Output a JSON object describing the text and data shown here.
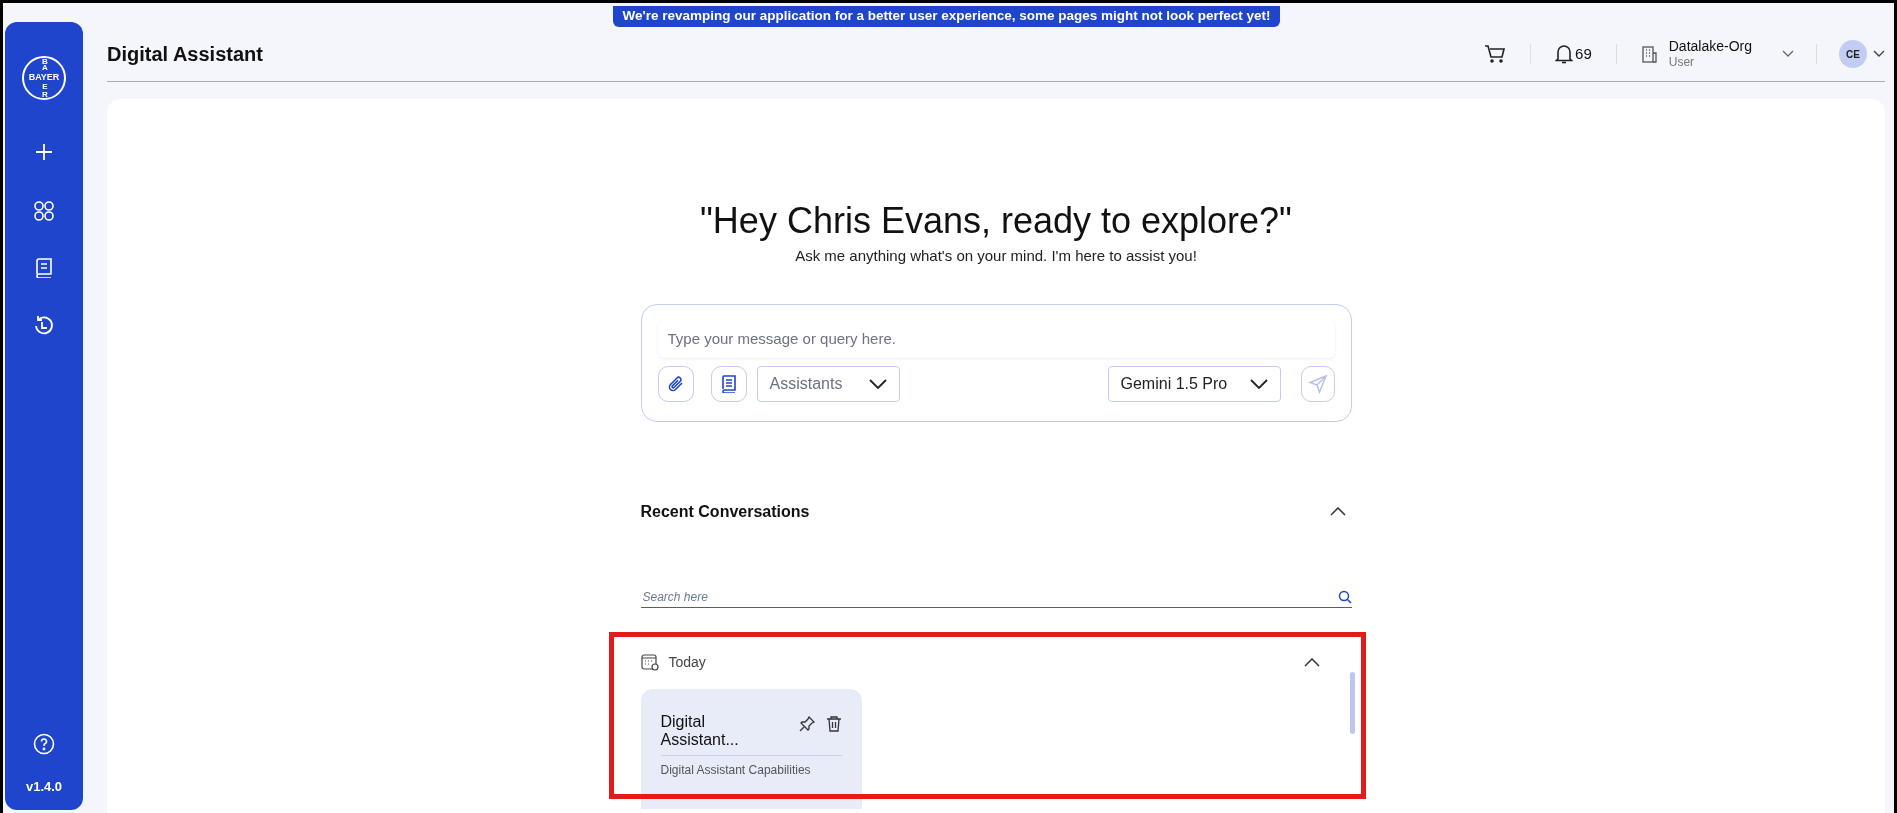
{
  "banner": "We're revamping our application for a better user experience, some pages might not look perfect yet!",
  "sidebar": {
    "logo": {
      "across": "BAYER",
      "down_top": "BA",
      "down_bottom": "ER"
    },
    "version": "v1.4.0"
  },
  "header": {
    "title": "Digital Assistant",
    "notifications": "69",
    "org": {
      "name": "Datalake-Org",
      "role": "User"
    },
    "avatar": "CE"
  },
  "greeting": {
    "title": "\"Hey Chris Evans, ready to explore?\"",
    "subtitle": "Ask me anything what's on your mind. I'm here to assist you!"
  },
  "composer": {
    "placeholder": "Type your message or query here.",
    "assistants": "Assistants",
    "model": "Gemini 1.5 Pro"
  },
  "recent": {
    "title": "Recent Conversations",
    "expanded": true,
    "search": {
      "placeholder": "Search here"
    },
    "groups": [
      {
        "label": "Today",
        "expanded": true,
        "items": [
          {
            "title": "Digital Assistant...",
            "subtitle": "Digital Assistant Capabilities"
          }
        ]
      }
    ]
  }
}
